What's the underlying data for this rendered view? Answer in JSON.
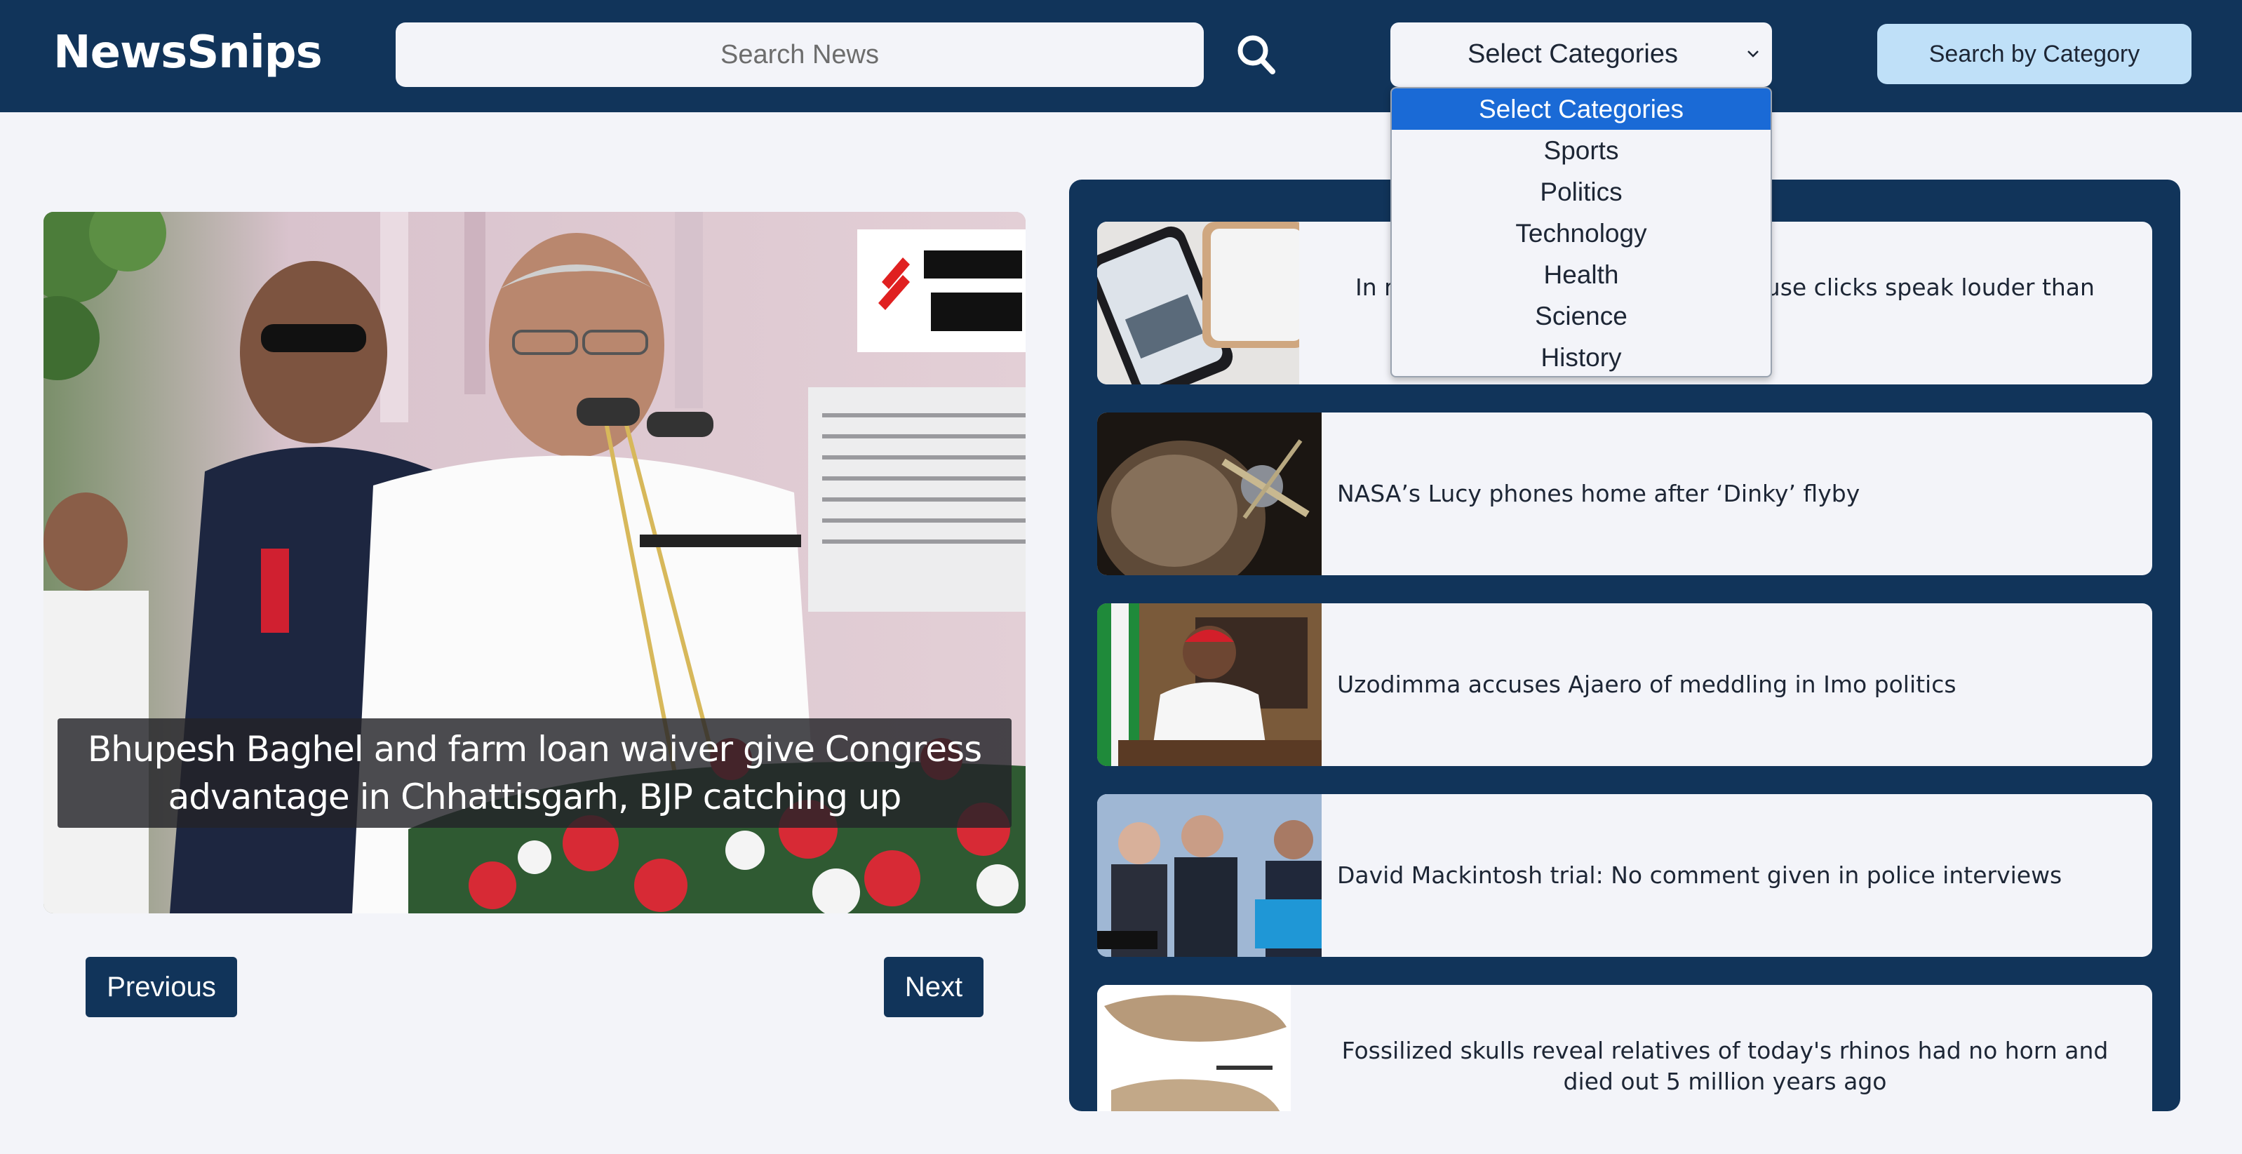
{
  "brand": "NewsSnips",
  "search": {
    "placeholder": "Search News"
  },
  "category_select": {
    "selected": "Select Categories",
    "options": [
      "Select Categories",
      "Sports",
      "Politics",
      "Technology",
      "Health",
      "Science",
      "History"
    ]
  },
  "category_button": "Search by Category",
  "carousel": {
    "caption": "Bhupesh Baghel and farm loan waiver give Congress advantage in Chhattisgarh, BJP catching up",
    "prev_label": "Previous",
    "next_label": "Next"
  },
  "news_list": [
    {
      "title": "In measuring political views, do mouse clicks speak louder than words?"
    },
    {
      "title": "NASA’s Lucy phones home after ‘Dinky’ flyby"
    },
    {
      "title": "Uzodimma accuses Ajaero of meddling in Imo politics"
    },
    {
      "title": "David Mackintosh trial: No comment given in police interviews"
    },
    {
      "title": "Fossilized skulls reveal relatives of today's rhinos had no horn and died out 5 million years ago"
    }
  ],
  "colors": {
    "navbar": "#11345a",
    "accent_button": "#bfe0f8",
    "selected_option": "#1a6ad6"
  }
}
